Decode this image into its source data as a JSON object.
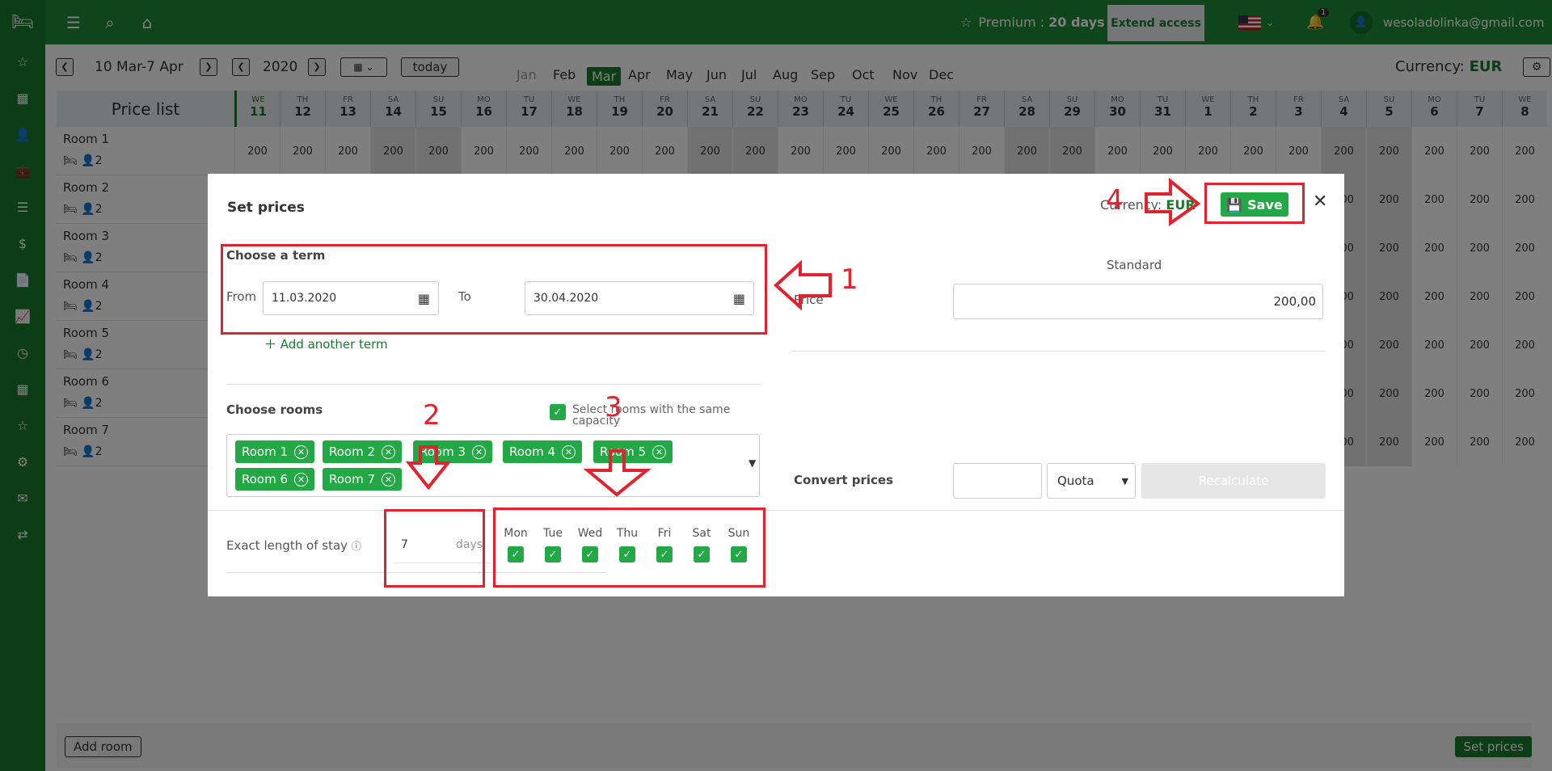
{
  "sidebar": {
    "logo": "bed-icon",
    "items": [
      "star-icon",
      "calendar-icon",
      "user-icon",
      "briefcase-icon",
      "list-icon",
      "dollar-icon",
      "document-icon",
      "chart-icon",
      "clock-icon",
      "grid-icon",
      "star-icon",
      "gear-icon",
      "mail-icon",
      "sync-icon"
    ]
  },
  "topbar": {
    "premium_label": "Premium : ",
    "premium_days": "20 days",
    "extend_label": "Extend access",
    "notifications_count": "1",
    "user_email": "wesoladolinka@gmail.com"
  },
  "controls": {
    "date_range": "10 Mar-7 Apr",
    "year": "2020",
    "today_label": "today",
    "months": [
      "Jan",
      "Feb",
      "Mar",
      "Apr",
      "May",
      "Jun",
      "Jul",
      "Aug",
      "Sep",
      "Oct",
      "Nov",
      "Dec"
    ],
    "active_month": "Mar",
    "currency_label": "Currency: ",
    "currency_value": "EUR"
  },
  "grid": {
    "header": "Price list",
    "days": [
      {
        "dw": "WE",
        "dn": "11"
      },
      {
        "dw": "TH",
        "dn": "12"
      },
      {
        "dw": "FR",
        "dn": "13"
      },
      {
        "dw": "SA",
        "dn": "14"
      },
      {
        "dw": "SU",
        "dn": "15"
      },
      {
        "dw": "MO",
        "dn": "16"
      },
      {
        "dw": "TU",
        "dn": "17"
      },
      {
        "dw": "WE",
        "dn": "18"
      },
      {
        "dw": "TH",
        "dn": "19"
      },
      {
        "dw": "FR",
        "dn": "20"
      },
      {
        "dw": "SA",
        "dn": "21"
      },
      {
        "dw": "SU",
        "dn": "22"
      },
      {
        "dw": "MO",
        "dn": "23"
      },
      {
        "dw": "TU",
        "dn": "24"
      },
      {
        "dw": "WE",
        "dn": "25"
      },
      {
        "dw": "TH",
        "dn": "26"
      },
      {
        "dw": "FR",
        "dn": "27"
      },
      {
        "dw": "SA",
        "dn": "28"
      },
      {
        "dw": "SU",
        "dn": "29"
      },
      {
        "dw": "MO",
        "dn": "30"
      },
      {
        "dw": "TU",
        "dn": "31"
      },
      {
        "dw": "WE",
        "dn": "1"
      },
      {
        "dw": "TH",
        "dn": "2"
      },
      {
        "dw": "FR",
        "dn": "3"
      },
      {
        "dw": "SA",
        "dn": "4"
      },
      {
        "dw": "SU",
        "dn": "5"
      },
      {
        "dw": "MO",
        "dn": "6"
      },
      {
        "dw": "TU",
        "dn": "7"
      },
      {
        "dw": "WE",
        "dn": "8"
      }
    ],
    "rooms": [
      {
        "name": "Room 1",
        "capacity": "2"
      },
      {
        "name": "Room 2",
        "capacity": "2"
      },
      {
        "name": "Room 3",
        "capacity": "2"
      },
      {
        "name": "Room 4",
        "capacity": "2"
      },
      {
        "name": "Room 5",
        "capacity": "2"
      },
      {
        "name": "Room 6",
        "capacity": "2"
      },
      {
        "name": "Room 7",
        "capacity": "2"
      }
    ],
    "price": "200"
  },
  "footer": {
    "add_room": "Add room",
    "set_prices": "Set prices"
  },
  "modal": {
    "title": "Set prices",
    "currency_label": "Currency: ",
    "currency_value": "EUR",
    "save_label": "Save",
    "term_title": "Choose a term",
    "from_label": "From",
    "from_value": "11.03.2020",
    "to_label": "To",
    "to_value": "30.04.2020",
    "add_term": "Add another term",
    "rooms_title": "Choose rooms",
    "same_capacity": "Select rooms with the same capacity",
    "selected_rooms": [
      "Room 1",
      "Room 2",
      "Room 3",
      "Room 4",
      "Room 5",
      "Room 6",
      "Room 7"
    ],
    "stay_label": "Exact length of stay",
    "stay_value": "7",
    "stay_unit": "days",
    "weekdays": [
      "Mon",
      "Tue",
      "Wed",
      "Thu",
      "Fri",
      "Sat",
      "Sun"
    ],
    "standard_label": "Standard",
    "price_label": "Price",
    "price_value": "200,00",
    "convert_label": "Convert prices",
    "quota_option": "Quota",
    "recalculate_label": "Recalculate"
  },
  "annotations": [
    "1",
    "2",
    "3",
    "4"
  ]
}
